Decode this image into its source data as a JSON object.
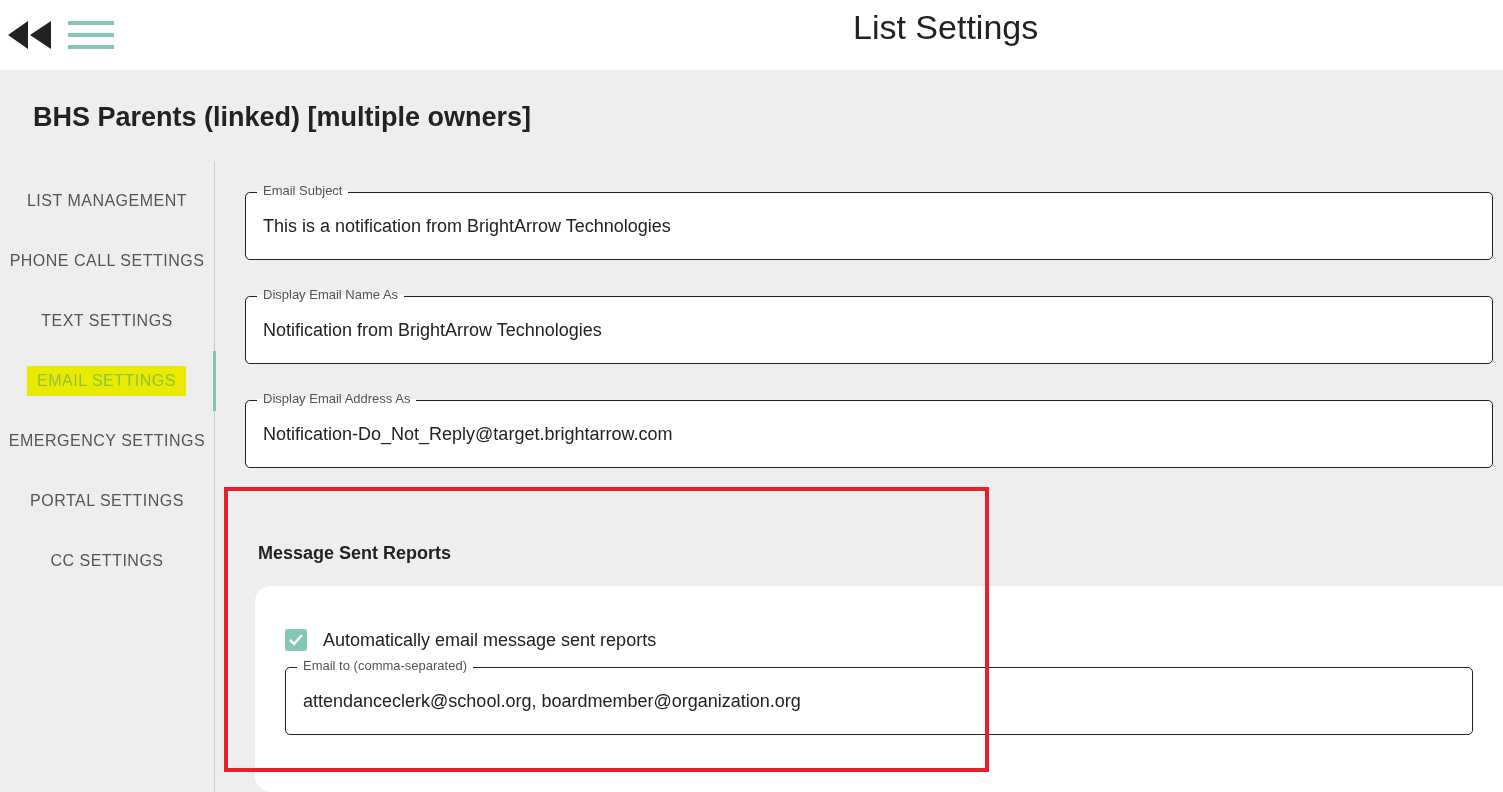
{
  "header": {
    "title": "List Settings"
  },
  "list_title": "BHS Parents (linked) [multiple owners]",
  "sidebar": {
    "items": [
      {
        "label": "LIST MANAGEMENT",
        "selected": false
      },
      {
        "label": "PHONE CALL SETTINGS",
        "selected": false
      },
      {
        "label": "TEXT SETTINGS",
        "selected": false
      },
      {
        "label": "EMAIL SETTINGS",
        "selected": true
      },
      {
        "label": "EMERGENCY SETTINGS",
        "selected": false
      },
      {
        "label": "PORTAL SETTINGS",
        "selected": false
      },
      {
        "label": "CC SETTINGS",
        "selected": false
      }
    ]
  },
  "fields": [
    {
      "label": "Email Subject",
      "value": "This is a notification from BrightArrow Technologies"
    },
    {
      "label": "Display Email Name As",
      "value": "Notification from BrightArrow Technologies"
    },
    {
      "label": "Display Email Address As",
      "value": "Notification-Do_Not_Reply@target.brightarrow.com"
    }
  ],
  "reports": {
    "heading": "Message Sent Reports",
    "checkbox": {
      "label": "Automatically email message sent reports",
      "checked": true
    },
    "email_to": {
      "label": "Email to (comma-separated)",
      "value": "attendanceclerk@school.org, boardmember@organization.org"
    }
  }
}
